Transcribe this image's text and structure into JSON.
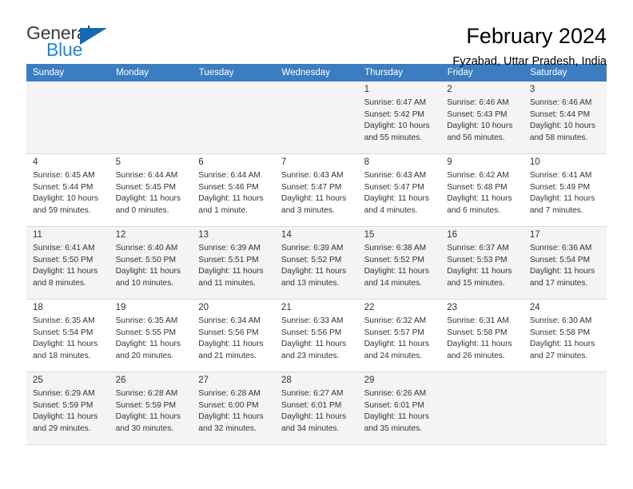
{
  "brand": {
    "name_top": "General",
    "name_bottom": "Blue",
    "accent_color": "#2586d0",
    "triangle_color": "#1668b3",
    "top_color": "#3b3b3b"
  },
  "header": {
    "title": "February 2024",
    "subtitle": "Fyzabad, Uttar Pradesh, India"
  },
  "theme": {
    "header_row_bg": "#3b7dc0",
    "header_row_text": "#ffffff",
    "shaded_row_bg": "#f4f4f4",
    "cell_border": "#d9d9d9"
  },
  "weekdays": [
    "Sunday",
    "Monday",
    "Tuesday",
    "Wednesday",
    "Thursday",
    "Friday",
    "Saturday"
  ],
  "labels": {
    "sunrise_prefix": "Sunrise:",
    "sunset_prefix": "Sunset:",
    "daylight_prefix": "Daylight:"
  },
  "weeks": [
    [
      {
        "day": ""
      },
      {
        "day": ""
      },
      {
        "day": ""
      },
      {
        "day": ""
      },
      {
        "day": "1",
        "sunrise": "Sunrise: 6:47 AM",
        "sunset": "Sunset: 5:42 PM",
        "daylight_line1": "Daylight: 10 hours",
        "daylight_line2": "and 55 minutes."
      },
      {
        "day": "2",
        "sunrise": "Sunrise: 6:46 AM",
        "sunset": "Sunset: 5:43 PM",
        "daylight_line1": "Daylight: 10 hours",
        "daylight_line2": "and 56 minutes."
      },
      {
        "day": "3",
        "sunrise": "Sunrise: 6:46 AM",
        "sunset": "Sunset: 5:44 PM",
        "daylight_line1": "Daylight: 10 hours",
        "daylight_line2": "and 58 minutes."
      }
    ],
    [
      {
        "day": "4",
        "sunrise": "Sunrise: 6:45 AM",
        "sunset": "Sunset: 5:44 PM",
        "daylight_line1": "Daylight: 10 hours",
        "daylight_line2": "and 59 minutes."
      },
      {
        "day": "5",
        "sunrise": "Sunrise: 6:44 AM",
        "sunset": "Sunset: 5:45 PM",
        "daylight_line1": "Daylight: 11 hours",
        "daylight_line2": "and 0 minutes."
      },
      {
        "day": "6",
        "sunrise": "Sunrise: 6:44 AM",
        "sunset": "Sunset: 5:46 PM",
        "daylight_line1": "Daylight: 11 hours",
        "daylight_line2": "and 1 minute."
      },
      {
        "day": "7",
        "sunrise": "Sunrise: 6:43 AM",
        "sunset": "Sunset: 5:47 PM",
        "daylight_line1": "Daylight: 11 hours",
        "daylight_line2": "and 3 minutes."
      },
      {
        "day": "8",
        "sunrise": "Sunrise: 6:43 AM",
        "sunset": "Sunset: 5:47 PM",
        "daylight_line1": "Daylight: 11 hours",
        "daylight_line2": "and 4 minutes."
      },
      {
        "day": "9",
        "sunrise": "Sunrise: 6:42 AM",
        "sunset": "Sunset: 5:48 PM",
        "daylight_line1": "Daylight: 11 hours",
        "daylight_line2": "and 6 minutes."
      },
      {
        "day": "10",
        "sunrise": "Sunrise: 6:41 AM",
        "sunset": "Sunset: 5:49 PM",
        "daylight_line1": "Daylight: 11 hours",
        "daylight_line2": "and 7 minutes."
      }
    ],
    [
      {
        "day": "11",
        "sunrise": "Sunrise: 6:41 AM",
        "sunset": "Sunset: 5:50 PM",
        "daylight_line1": "Daylight: 11 hours",
        "daylight_line2": "and 8 minutes."
      },
      {
        "day": "12",
        "sunrise": "Sunrise: 6:40 AM",
        "sunset": "Sunset: 5:50 PM",
        "daylight_line1": "Daylight: 11 hours",
        "daylight_line2": "and 10 minutes."
      },
      {
        "day": "13",
        "sunrise": "Sunrise: 6:39 AM",
        "sunset": "Sunset: 5:51 PM",
        "daylight_line1": "Daylight: 11 hours",
        "daylight_line2": "and 11 minutes."
      },
      {
        "day": "14",
        "sunrise": "Sunrise: 6:39 AM",
        "sunset": "Sunset: 5:52 PM",
        "daylight_line1": "Daylight: 11 hours",
        "daylight_line2": "and 13 minutes."
      },
      {
        "day": "15",
        "sunrise": "Sunrise: 6:38 AM",
        "sunset": "Sunset: 5:52 PM",
        "daylight_line1": "Daylight: 11 hours",
        "daylight_line2": "and 14 minutes."
      },
      {
        "day": "16",
        "sunrise": "Sunrise: 6:37 AM",
        "sunset": "Sunset: 5:53 PM",
        "daylight_line1": "Daylight: 11 hours",
        "daylight_line2": "and 15 minutes."
      },
      {
        "day": "17",
        "sunrise": "Sunrise: 6:36 AM",
        "sunset": "Sunset: 5:54 PM",
        "daylight_line1": "Daylight: 11 hours",
        "daylight_line2": "and 17 minutes."
      }
    ],
    [
      {
        "day": "18",
        "sunrise": "Sunrise: 6:35 AM",
        "sunset": "Sunset: 5:54 PM",
        "daylight_line1": "Daylight: 11 hours",
        "daylight_line2": "and 18 minutes."
      },
      {
        "day": "19",
        "sunrise": "Sunrise: 6:35 AM",
        "sunset": "Sunset: 5:55 PM",
        "daylight_line1": "Daylight: 11 hours",
        "daylight_line2": "and 20 minutes."
      },
      {
        "day": "20",
        "sunrise": "Sunrise: 6:34 AM",
        "sunset": "Sunset: 5:56 PM",
        "daylight_line1": "Daylight: 11 hours",
        "daylight_line2": "and 21 minutes."
      },
      {
        "day": "21",
        "sunrise": "Sunrise: 6:33 AM",
        "sunset": "Sunset: 5:56 PM",
        "daylight_line1": "Daylight: 11 hours",
        "daylight_line2": "and 23 minutes."
      },
      {
        "day": "22",
        "sunrise": "Sunrise: 6:32 AM",
        "sunset": "Sunset: 5:57 PM",
        "daylight_line1": "Daylight: 11 hours",
        "daylight_line2": "and 24 minutes."
      },
      {
        "day": "23",
        "sunrise": "Sunrise: 6:31 AM",
        "sunset": "Sunset: 5:58 PM",
        "daylight_line1": "Daylight: 11 hours",
        "daylight_line2": "and 26 minutes."
      },
      {
        "day": "24",
        "sunrise": "Sunrise: 6:30 AM",
        "sunset": "Sunset: 5:58 PM",
        "daylight_line1": "Daylight: 11 hours",
        "daylight_line2": "and 27 minutes."
      }
    ],
    [
      {
        "day": "25",
        "sunrise": "Sunrise: 6:29 AM",
        "sunset": "Sunset: 5:59 PM",
        "daylight_line1": "Daylight: 11 hours",
        "daylight_line2": "and 29 minutes."
      },
      {
        "day": "26",
        "sunrise": "Sunrise: 6:28 AM",
        "sunset": "Sunset: 5:59 PM",
        "daylight_line1": "Daylight: 11 hours",
        "daylight_line2": "and 30 minutes."
      },
      {
        "day": "27",
        "sunrise": "Sunrise: 6:28 AM",
        "sunset": "Sunset: 6:00 PM",
        "daylight_line1": "Daylight: 11 hours",
        "daylight_line2": "and 32 minutes."
      },
      {
        "day": "28",
        "sunrise": "Sunrise: 6:27 AM",
        "sunset": "Sunset: 6:01 PM",
        "daylight_line1": "Daylight: 11 hours",
        "daylight_line2": "and 34 minutes."
      },
      {
        "day": "29",
        "sunrise": "Sunrise: 6:26 AM",
        "sunset": "Sunset: 6:01 PM",
        "daylight_line1": "Daylight: 11 hours",
        "daylight_line2": "and 35 minutes."
      },
      {
        "day": ""
      },
      {
        "day": ""
      }
    ]
  ]
}
